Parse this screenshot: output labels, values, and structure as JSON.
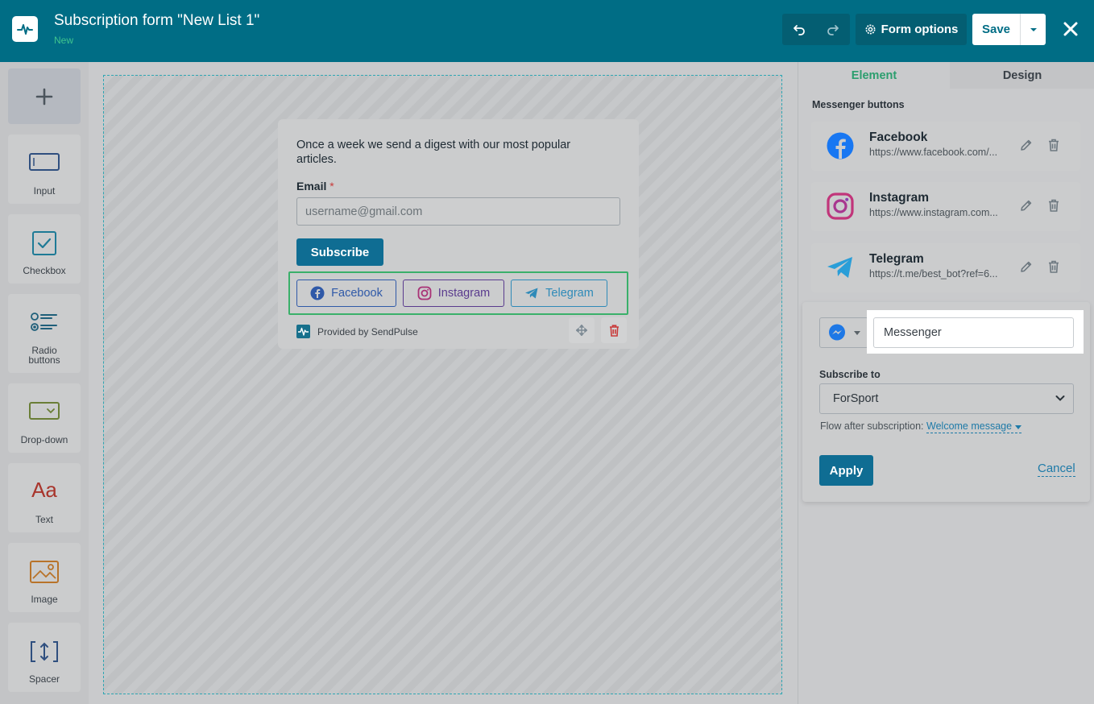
{
  "header": {
    "title": "Subscription form \"New List 1\"",
    "status": "New",
    "form_options_label": "Form options",
    "save_label": "Save"
  },
  "toolbar": {
    "items": [
      {
        "label": "Input",
        "icon": "input-icon"
      },
      {
        "label": "Checkbox",
        "icon": "checkbox-icon"
      },
      {
        "label": "Radio\nbuttons",
        "label_line1": "Radio",
        "label_line2": "buttons",
        "icon": "radio-buttons-icon"
      },
      {
        "label": "Drop-down",
        "icon": "dropdown-icon"
      },
      {
        "label": "Text",
        "icon": "text-icon",
        "glyph": "Aa"
      },
      {
        "label": "Image",
        "icon": "image-icon"
      },
      {
        "label": "Spacer",
        "icon": "spacer-icon"
      }
    ]
  },
  "form": {
    "intro": "Once a week we send a digest with our most popular articles.",
    "email_label": "Email",
    "required_mark": "*",
    "email_placeholder": "username@gmail.com",
    "subscribe_label": "Subscribe",
    "messengers": [
      {
        "label": "Facebook",
        "color": "#2f59a8"
      },
      {
        "label": "Instagram",
        "color": "#5a3b8e"
      },
      {
        "label": "Telegram",
        "color": "#2e8ab8"
      }
    ],
    "provided_by": "Provided by SendPulse"
  },
  "panel": {
    "tabs": [
      {
        "label": "Element",
        "active": true
      },
      {
        "label": "Design",
        "active": false
      }
    ],
    "section_label": "Messenger buttons",
    "messengers": [
      {
        "name": "Facebook",
        "url": "https://www.facebook.com/...",
        "icon": "facebook-icon"
      },
      {
        "name": "Instagram",
        "url": "https://www.instagram.com...",
        "icon": "instagram-icon"
      },
      {
        "name": "Telegram",
        "url": "https://t.me/best_bot?ref=6...",
        "icon": "telegram-icon"
      }
    ],
    "editor": {
      "selected_icon": "messenger-icon",
      "name_value": "Messenger",
      "subscribe_to_label": "Subscribe to",
      "subscribe_to_value": "ForSport",
      "flow_label": "Flow after subscription:",
      "flow_value": "Welcome message",
      "apply_label": "Apply",
      "cancel_label": "Cancel"
    }
  },
  "colors": {
    "header_bg": "#006d85",
    "accent_green": "#2b9e6e",
    "primary_button": "#0f6d93",
    "link": "#1e7aa8"
  }
}
